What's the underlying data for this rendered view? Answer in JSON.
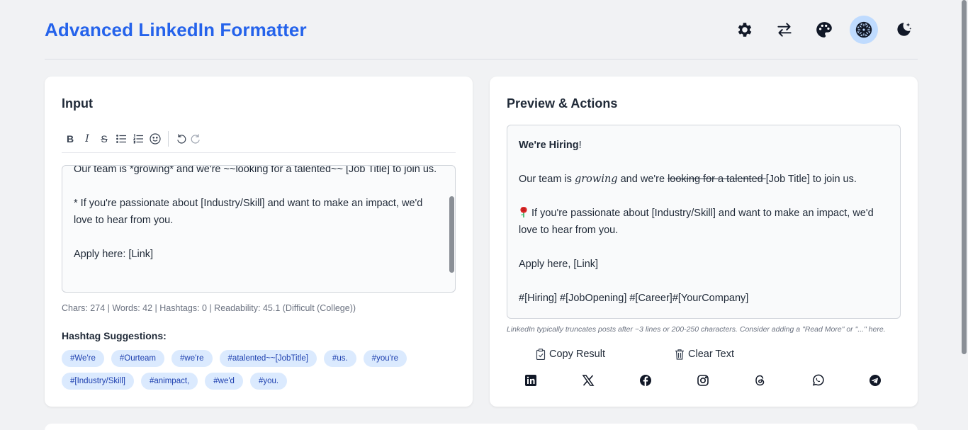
{
  "app": {
    "title": "Advanced LinkedIn Formatter"
  },
  "header": {
    "icons": [
      "gear-icon",
      "swap-icon",
      "palette-icon",
      "flower-icon",
      "moon-icon"
    ]
  },
  "input": {
    "title": "Input",
    "toolbar": {
      "bold": "B",
      "italic": "I",
      "strike": "S"
    },
    "text": "Our team is *growing* and we're ~~looking for a talented~~ [Job Title] to join us.\n\n* If you're passionate about [Industry/Skill] and want to make an impact, we'd love to hear from you.\n\nApply here: [Link]",
    "stats": "Chars: 274 | Words: 42 | Hashtags: 0 | Readability: 45.1 (Difficult (College))",
    "suggestions_title": "Hashtag Suggestions:",
    "hashtags": [
      "#We're",
      "#Ourteam",
      "#we're",
      "#atalented~~[JobTitle]",
      "#us.",
      "#you're",
      "#[Industry/Skill]",
      "#animpact,",
      "#we'd",
      "#you."
    ]
  },
  "preview": {
    "title": "Preview & Actions",
    "heading": "We're Hiring",
    "heading_suffix": "!",
    "line2_a": "Our team is ",
    "line2_italic": "growing",
    "line2_b": " and we're ",
    "line2_strike": "looking for a talented ",
    "line2_c": "[Job Title] to join us.",
    "line3": "If you're passionate about [Industry/Skill] and want to make an impact, we'd love to hear from you.",
    "line4": "Apply here, [Link]",
    "line5": "#[Hiring] #[JobOpening] #[Career]#[YourCompany]",
    "hint": "LinkedIn typically truncates posts after ~3 lines or 200-250 characters. Consider adding a \"Read More\" or \"...\" here.",
    "copy_label": "Copy Result",
    "clear_label": "Clear Text",
    "share_icons": [
      "linkedin-icon",
      "x-icon",
      "facebook-icon",
      "instagram-icon",
      "threads-icon",
      "whatsapp-icon",
      "telegram-icon"
    ]
  },
  "colors": {
    "accent": "#2563eb",
    "chip_bg": "#dbeafe",
    "chip_text": "#1e40af",
    "active_icon_bg": "#bfdbfe"
  }
}
